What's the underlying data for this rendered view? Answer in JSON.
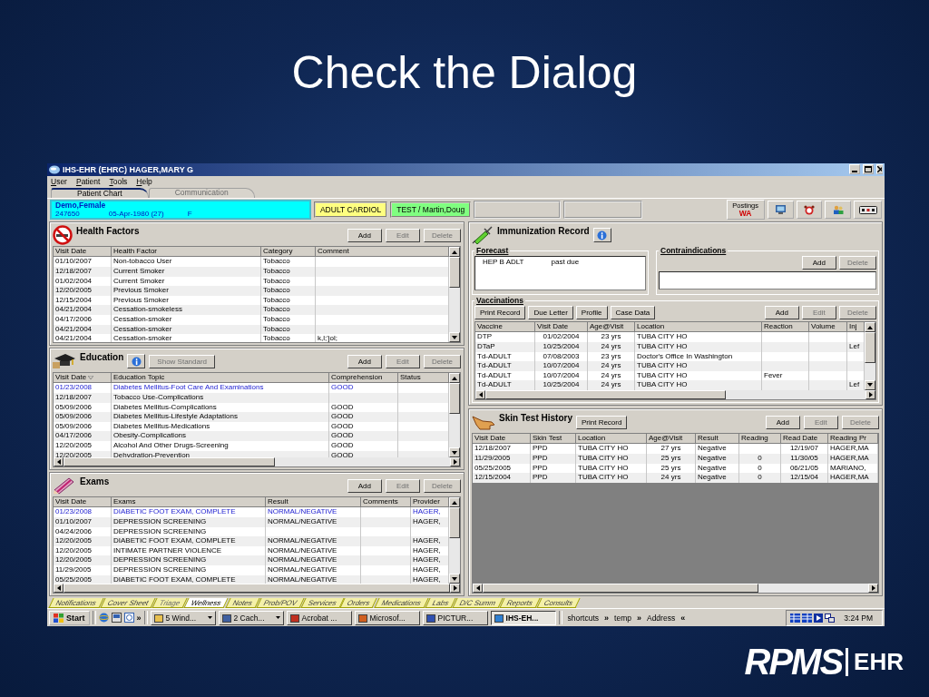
{
  "slide": {
    "title": "Check the Dialog",
    "logo": "RPMS",
    "logo_suffix": "EHR"
  },
  "window": {
    "title": "IHS-EHR (EHRC) HAGER,MARY G",
    "menu": [
      "User",
      "Patient",
      "Tools",
      "Help"
    ],
    "tabs": [
      {
        "label": "Patient Chart",
        "selected": true,
        "disabled": false
      },
      {
        "label": "Communication",
        "selected": false,
        "disabled": true
      }
    ]
  },
  "patient": {
    "name": "Demo,Female",
    "chart": "247650",
    "dob": "05-Apr-1980 (27)",
    "sex": "F"
  },
  "banner_boxes": [
    {
      "text": "ADULT CARDIOL",
      "color": "#ffff80"
    },
    {
      "text": "TEST / Martin,Doug",
      "color": "#80ff80"
    }
  ],
  "postings": {
    "label": "Postings",
    "value": "WA"
  },
  "health_factors": {
    "title": "Health Factors",
    "buttons": [
      {
        "label": "Add",
        "disabled": false
      },
      {
        "label": "Edit",
        "disabled": true
      },
      {
        "label": "Delete",
        "disabled": true
      }
    ],
    "table": {
      "columns": [
        {
          "label": "Visit Date"
        },
        {
          "label": "Health Factor"
        },
        {
          "label": "Category"
        },
        {
          "label": "Comment"
        }
      ],
      "rows": [
        {
          "cells": [
            "01/10/2007",
            "Non-tobacco User",
            "Tobacco",
            ""
          ],
          "selected": false
        },
        {
          "cells": [
            "12/18/2007",
            "Current Smoker",
            "Tobacco",
            ""
          ],
          "selected": false
        },
        {
          "cells": [
            "01/02/2004",
            "Current Smoker",
            "Tobacco",
            ""
          ],
          "selected": false
        },
        {
          "cells": [
            "12/20/2005",
            "Previous Smoker",
            "Tobacco",
            ""
          ],
          "selected": false
        },
        {
          "cells": [
            "12/15/2004",
            "Previous Smoker",
            "Tobacco",
            ""
          ],
          "selected": false
        },
        {
          "cells": [
            "04/21/2004",
            "Cessation-smokeless",
            "Tobacco",
            ""
          ],
          "selected": false
        },
        {
          "cells": [
            "04/17/2006",
            "Cessation-smoker",
            "Tobacco",
            ""
          ],
          "selected": false
        },
        {
          "cells": [
            "04/21/2004",
            "Cessation-smoker",
            "Tobacco",
            ""
          ],
          "selected": false
        },
        {
          "cells": [
            "04/21/2004",
            "Cessation-smoker",
            "Tobacco",
            "k,l;'jol;"
          ],
          "selected": false
        }
      ]
    }
  },
  "education": {
    "title": "Education",
    "extra_button": {
      "label": "Show Standard",
      "disabled": true
    },
    "buttons": [
      {
        "label": "Add",
        "disabled": false
      },
      {
        "label": "Edit",
        "disabled": true
      },
      {
        "label": "Delete",
        "disabled": true
      }
    ],
    "table": {
      "columns": [
        {
          "label": "Visit Date",
          "sorted": true
        },
        {
          "label": "Education Topic",
          "sorted": false
        },
        {
          "label": "Comprehension",
          "sorted": false
        },
        {
          "label": "Status",
          "sorted": false
        }
      ],
      "rows": [
        {
          "cells": [
            "01/23/2008",
            "Diabetes Mellitus-Foot Care And Examinations",
            "GOOD",
            ""
          ],
          "selected": true
        },
        {
          "cells": [
            "12/18/2007",
            "Tobacco Use-Complications",
            "",
            ""
          ],
          "selected": false
        },
        {
          "cells": [
            "05/09/2006",
            "Diabetes Mellitus-Complications",
            "GOOD",
            ""
          ],
          "selected": false
        },
        {
          "cells": [
            "05/09/2006",
            "Diabetes Mellitus-Lifestyle Adaptations",
            "GOOD",
            ""
          ],
          "selected": false
        },
        {
          "cells": [
            "05/09/2006",
            "Diabetes Mellitus-Medications",
            "GOOD",
            ""
          ],
          "selected": false
        },
        {
          "cells": [
            "04/17/2006",
            "Obesity-Complications",
            "GOOD",
            ""
          ],
          "selected": false
        },
        {
          "cells": [
            "12/20/2005",
            "Alcohol And Other Drugs-Screening",
            "GOOD",
            ""
          ],
          "selected": false
        },
        {
          "cells": [
            "12/20/2005",
            "Dehydration-Prevention",
            "GOOD",
            ""
          ],
          "selected": false
        }
      ]
    }
  },
  "exams": {
    "title": "Exams",
    "buttons": [
      {
        "label": "Add",
        "disabled": false
      },
      {
        "label": "Edit",
        "disabled": true
      },
      {
        "label": "Delete",
        "disabled": true
      }
    ],
    "table": {
      "columns": [
        {
          "label": "Visit Date"
        },
        {
          "label": "Exams"
        },
        {
          "label": "Result"
        },
        {
          "label": "Comments"
        },
        {
          "label": "Provider"
        }
      ],
      "rows": [
        {
          "cells": [
            "01/23/2008",
            "DIABETIC FOOT EXAM, COMPLETE",
            "NORMAL/NEGATIVE",
            "",
            "HAGER,"
          ],
          "selected": true
        },
        {
          "cells": [
            "01/10/2007",
            "DEPRESSION SCREENING",
            "NORMAL/NEGATIVE",
            "",
            "HAGER,"
          ],
          "selected": false
        },
        {
          "cells": [
            "04/24/2006",
            "DEPRESSION SCREENING",
            "",
            "",
            ""
          ],
          "selected": false
        },
        {
          "cells": [
            "12/20/2005",
            "DIABETIC FOOT EXAM, COMPLETE",
            "NORMAL/NEGATIVE",
            "",
            "HAGER,"
          ],
          "selected": false
        },
        {
          "cells": [
            "12/20/2005",
            "INTIMATE PARTNER VIOLENCE",
            "NORMAL/NEGATIVE",
            "",
            "HAGER,"
          ],
          "selected": false
        },
        {
          "cells": [
            "12/20/2005",
            "DEPRESSION SCREENING",
            "NORMAL/NEGATIVE",
            "",
            "HAGER,"
          ],
          "selected": false
        },
        {
          "cells": [
            "11/29/2005",
            "DEPRESSION SCREENING",
            "NORMAL/NEGATIVE",
            "",
            "HAGER,"
          ],
          "selected": false
        },
        {
          "cells": [
            "05/25/2005",
            "DIABETIC FOOT EXAM, COMPLETE",
            "NORMAL/NEGATIVE",
            "",
            "HAGER,"
          ],
          "selected": false
        }
      ]
    }
  },
  "immunization": {
    "title": "Immunization Record",
    "forecast": {
      "label": "Forecast",
      "items": [
        {
          "vaccine": "HEP B ADLT",
          "status": "past due"
        }
      ]
    },
    "contraindications": {
      "label": "Contraindications",
      "buttons": [
        {
          "label": "Add",
          "disabled": false
        },
        {
          "label": "Delete",
          "disabled": true
        }
      ]
    },
    "vaccinations": {
      "label": "Vaccinations",
      "tools": [
        {
          "label": "Print Record"
        },
        {
          "label": "Due Letter"
        },
        {
          "label": "Profile"
        },
        {
          "label": "Case Data"
        }
      ],
      "buttons": [
        {
          "label": "Add",
          "disabled": false
        },
        {
          "label": "Edit",
          "disabled": true
        },
        {
          "label": "Delete",
          "disabled": true
        }
      ],
      "table": {
        "columns": [
          {
            "label": "Vaccine"
          },
          {
            "label": "Visit Date"
          },
          {
            "label": "Age@Visit"
          },
          {
            "label": "Location"
          },
          {
            "label": "Reaction"
          },
          {
            "label": "Volume"
          },
          {
            "label": "Inj"
          }
        ],
        "rows": [
          {
            "cells": [
              "DTP",
              "01/02/2004",
              "23 yrs",
              "TUBA CITY HO",
              "",
              "",
              ""
            ],
            "selected": false
          },
          {
            "cells": [
              "DTaP",
              "10/25/2004",
              "24 yrs",
              "TUBA CITY HO",
              "",
              "",
              "Lef"
            ],
            "selected": false
          },
          {
            "cells": [
              "Td-ADULT",
              "07/08/2003",
              "23 yrs",
              "Doctor's Office In Washington",
              "",
              "",
              ""
            ],
            "selected": false
          },
          {
            "cells": [
              "Td-ADULT",
              "10/07/2004",
              "24 yrs",
              "TUBA CITY HO",
              "",
              "",
              ""
            ],
            "selected": false
          },
          {
            "cells": [
              "Td-ADULT",
              "10/07/2004",
              "24 yrs",
              "TUBA CITY HO",
              "Fever",
              "",
              ""
            ],
            "selected": false
          },
          {
            "cells": [
              "Td-ADULT",
              "10/25/2004",
              "24 yrs",
              "TUBA CITY HO",
              "",
              "",
              "Lef"
            ],
            "selected": false
          }
        ]
      }
    }
  },
  "skin_tests": {
    "title": "Skin Test History",
    "print_button": "Print Record",
    "buttons": [
      {
        "label": "Add",
        "disabled": false
      },
      {
        "label": "Edit",
        "disabled": true
      },
      {
        "label": "Delete",
        "disabled": true
      }
    ],
    "table": {
      "columns": [
        {
          "label": "Visit Date"
        },
        {
          "label": "Skin Test"
        },
        {
          "label": "Location"
        },
        {
          "label": "Age@Visit"
        },
        {
          "label": "Result"
        },
        {
          "label": "Reading"
        },
        {
          "label": "Read Date"
        },
        {
          "label": "Reading Pr"
        }
      ],
      "rows": [
        {
          "cells": [
            "12/18/2007",
            "PPD",
            "TUBA CITY HO",
            "27 yrs",
            "Negative",
            "",
            "12/19/07",
            "HAGER,MA"
          ],
          "selected": false
        },
        {
          "cells": [
            "11/29/2005",
            "PPD",
            "TUBA CITY HO",
            "25 yrs",
            "Negative",
            "0",
            "11/30/05",
            "HAGER,MA"
          ],
          "selected": false
        },
        {
          "cells": [
            "05/25/2005",
            "PPD",
            "TUBA CITY HO",
            "25 yrs",
            "Negative",
            "0",
            "06/21/05",
            "MARIANO,"
          ],
          "selected": false
        },
        {
          "cells": [
            "12/15/2004",
            "PPD",
            "TUBA CITY HO",
            "24 yrs",
            "Negative",
            "0",
            "12/15/04",
            "HAGER,MA"
          ],
          "selected": false
        }
      ]
    }
  },
  "chart_tabs": [
    {
      "label": "Notifications",
      "selected": false,
      "disabled": false
    },
    {
      "label": "Cover Sheet",
      "selected": false,
      "disabled": false
    },
    {
      "label": "Triage",
      "selected": false,
      "disabled": true
    },
    {
      "label": "Wellness",
      "selected": true,
      "disabled": false
    },
    {
      "label": "Notes",
      "selected": false,
      "disabled": false
    },
    {
      "label": "Prob/POV",
      "selected": false,
      "disabled": false
    },
    {
      "label": "Services",
      "selected": false,
      "disabled": false
    },
    {
      "label": "Orders",
      "selected": false,
      "disabled": false
    },
    {
      "label": "Medications",
      "selected": false,
      "disabled": false
    },
    {
      "label": "Labs",
      "selected": false,
      "disabled": false
    },
    {
      "label": "D/C Summ",
      "selected": false,
      "disabled": false
    },
    {
      "label": "Reports",
      "selected": false,
      "disabled": false
    },
    {
      "label": "Consults",
      "selected": false,
      "disabled": false
    }
  ],
  "taskbar": {
    "start": "Start",
    "quick_launch_more": "»",
    "tasks": [
      {
        "label": "5 Wind...",
        "dropdown": true,
        "active": false
      },
      {
        "label": "2 Cach...",
        "dropdown": true,
        "active": false
      },
      {
        "label": "Acrobat ...",
        "dropdown": false,
        "active": false
      },
      {
        "label": "Microsof...",
        "dropdown": false,
        "active": false
      },
      {
        "label": "PICTUR...",
        "dropdown": false,
        "active": false
      },
      {
        "label": "IHS-EH...",
        "dropdown": false,
        "active": true
      }
    ],
    "toolbars": [
      {
        "label": "shortcuts",
        "chevron": "»"
      },
      {
        "label": "temp",
        "chevron": "»"
      },
      {
        "label": "Address",
        "chevron": "«"
      }
    ],
    "clock": "3:24 PM"
  }
}
